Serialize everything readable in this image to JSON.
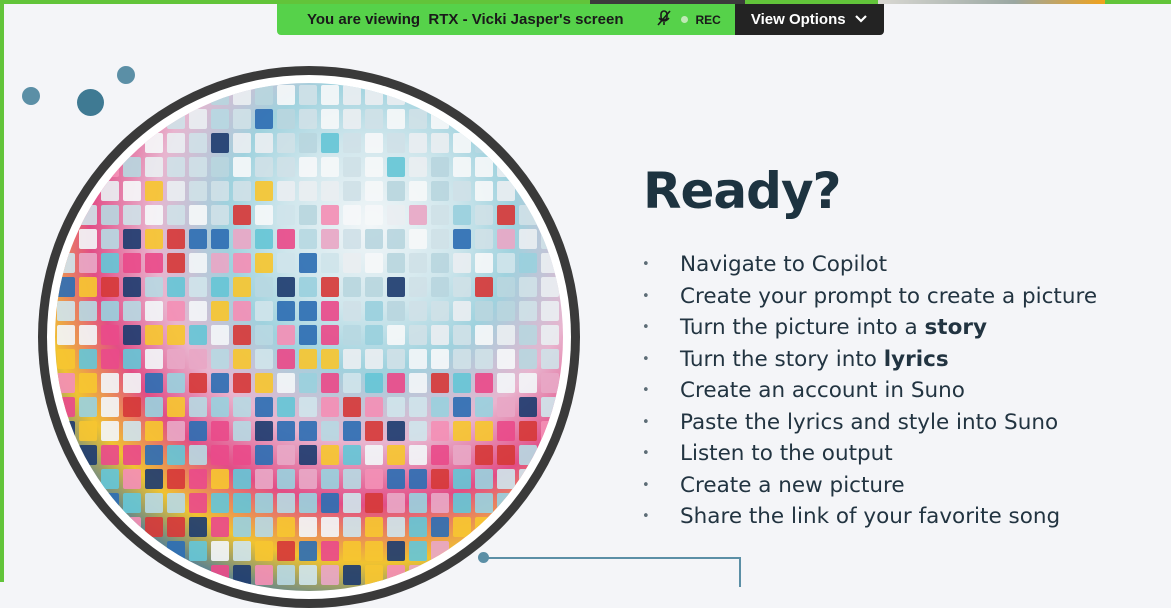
{
  "banner": {
    "viewing_text": "You are viewing  RTX - Vicki Jasper's screen",
    "rec_label": "REC",
    "view_options_label": "View Options"
  },
  "slide": {
    "title": "Ready?",
    "steps": [
      {
        "text": "Navigate to Copilot",
        "bold": ""
      },
      {
        "text": "Create your prompt to create a picture",
        "bold": ""
      },
      {
        "text": "Turn the picture into a ",
        "bold": "story"
      },
      {
        "text": "Turn the story into ",
        "bold": "lyrics"
      },
      {
        "text": "Create an account in Suno",
        "bold": ""
      },
      {
        "text": "Paste the lyrics and style into Suno",
        "bold": ""
      },
      {
        "text": "Listen to the output",
        "bold": ""
      },
      {
        "text": "Create a new picture",
        "bold": ""
      },
      {
        "text": "Share the link of your favorite song",
        "bold": ""
      }
    ]
  },
  "colors": {
    "share_frame": "#62c43a",
    "banner_green": "#56d24a",
    "banner_dark": "#232323",
    "title": "#1d3340",
    "accent": "#5b8fa6"
  },
  "icons": [
    "microphone-muted-icon",
    "recording-dot-icon",
    "chevron-down-icon"
  ]
}
